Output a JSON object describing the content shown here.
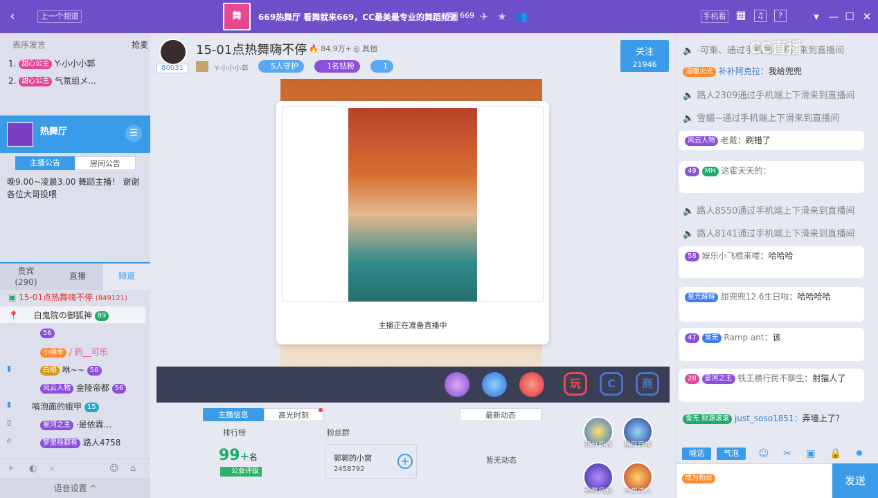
{
  "titlebar": {
    "prev_channel": "上一个频道",
    "logo_text": "舞",
    "title": "669热舞厅 看舞就来669，CC最美最专业的舞蹈频道",
    "id_label": "ID",
    "id_value": "669",
    "mobile_watch": "手机看"
  },
  "left": {
    "header_left": "表序发言",
    "header_right": "抢麦",
    "queue": [
      {
        "rank": "1.",
        "badge": "甜心公主",
        "name": "Y-小小小郭"
      },
      {
        "rank": "2.",
        "badge": "甜心公主",
        "name": "气氛组メ..."
      }
    ],
    "channel_name": "热舞厅",
    "notice_tabs": [
      "主播公告",
      "房间公告"
    ],
    "notice_text": "晚9.00~凌晨3.00 舞蹈主播！ 谢谢各位大哥投喂",
    "tabs": [
      {
        "label": "贵宾",
        "sub": "(290)"
      },
      {
        "label": "直播",
        "sub": ""
      },
      {
        "label": "频道",
        "sub": ""
      }
    ],
    "current_room": "15-01点热舞嗨不停",
    "current_room_count": "(849121)",
    "users": [
      {
        "name": "白鬼院の御狐神",
        "badge": "",
        "level": "89"
      },
      {
        "name": "",
        "badge": "",
        "level": "56"
      },
      {
        "name": "小确幸 / 药__可乐",
        "badge": "小确幸",
        "level": ""
      },
      {
        "name": "白眼 咻~~",
        "badge": "白眼",
        "level": "58"
      },
      {
        "name": "风云人物 金陵帝都",
        "badge": "风云人物",
        "level": "56"
      },
      {
        "name": "啃泡面的蛾甲",
        "badge": "",
        "level": "15"
      },
      {
        "name": "星河之主 ·是依霖...",
        "badge": "星河之主",
        "level": ""
      },
      {
        "name": "梦里啥都有 路人4758",
        "badge": "梦里啥都有",
        "level": ""
      }
    ],
    "voice_settings": "语音设置 ^"
  },
  "room": {
    "room_id": "80031",
    "title": "15-01点热舞嗨不停",
    "heat": "84.9万+",
    "category": "其他",
    "anchor_name": "Y-小小小郭",
    "guard": "5人守护",
    "diamond": "1名钻粉",
    "fans": "1",
    "follow_label": "关注",
    "follow_count": "21946",
    "status_text": "主播正在准备直播中"
  },
  "bottom": {
    "tabs": [
      "主播信息",
      "高光时刻"
    ],
    "latest_tab": "最新动态",
    "rank_label": "排行榜",
    "rank_value": "99",
    "rank_plus": "+",
    "rank_unit": "名",
    "guild_label": "公会评级",
    "fans_label": "粉丝群",
    "fan_group_name": "郭郭的小窝",
    "fan_group_id": "2458792",
    "no_news": "暂无动态",
    "circle_buttons": [
      "积分商城",
      "星际穿梭",
      "弹幕风暴",
      "水果达人"
    ]
  },
  "chat": {
    "watermark": "CC直播",
    "messages": [
      {
        "type": "sys",
        "text": "-可乘、通过手机端上下滑来到直播间"
      },
      {
        "type": "plain",
        "badge": "温暖火光",
        "name": "补补阿克拉：",
        "text": "我给兜兜"
      },
      {
        "type": "sys",
        "text": "路人2309通过手机端上下滑来到直播间"
      },
      {
        "type": "sys",
        "text": "雪媚~通过手机端上下滑来到直播间"
      },
      {
        "type": "bubble",
        "badge": "风云人物",
        "name": "老戴",
        "text": "：刷错了"
      },
      {
        "type": "bubble",
        "badge": "MH",
        "name": "",
        "text": "这霍天天的："
      },
      {
        "type": "sys",
        "text": "路人8550通过手机端上下滑来到直播间"
      },
      {
        "type": "sys",
        "text": "路人8141通过手机端上下滑来到直播间"
      },
      {
        "type": "bubble",
        "badge": "",
        "name": "娱乐小飞棍来喽",
        "text": "：哈哈哈"
      },
      {
        "type": "bubble",
        "badge": "星光耀耀",
        "name": "甜兜兜12.6生日啦",
        "text": "：哈哈哈哈"
      },
      {
        "type": "bubble",
        "badge": "雪无",
        "name": "Ramp ant",
        "text": "：该"
      },
      {
        "type": "bubble",
        "badge": "星河之主",
        "name": "铁王横行民不聊生",
        "text": "：射猫人了"
      },
      {
        "type": "plain",
        "badge": "雪无 财源滚滚",
        "name": "just_soso1851：",
        "text": "弄墙上了？"
      }
    ],
    "toolbar": [
      "喊话",
      "气泡"
    ],
    "input_badge": "成为粉丝",
    "send": "发送"
  }
}
